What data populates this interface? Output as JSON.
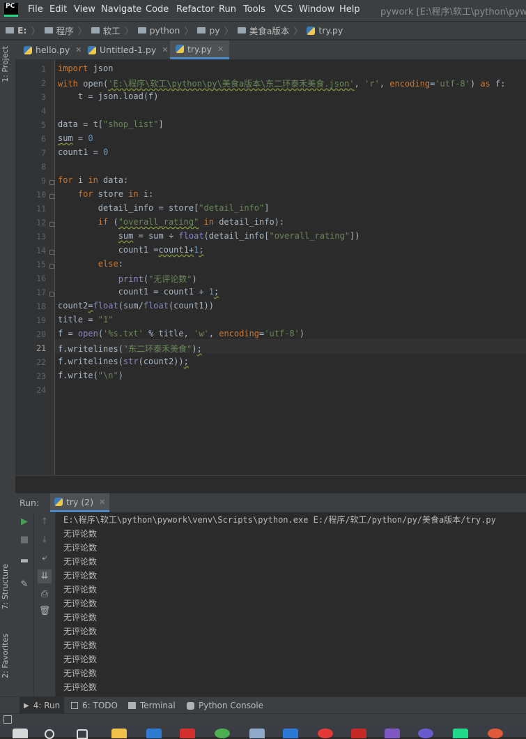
{
  "menubar": {
    "logo": "PC",
    "items": [
      "File",
      "Edit",
      "View",
      "Navigate",
      "Code",
      "Refactor",
      "Run",
      "Tools",
      "VCS",
      "Window",
      "Help"
    ],
    "window_title": "pywork [E:\\程序\\软工\\python\\pywork"
  },
  "breadcrumb": [
    "E:",
    "程序",
    "软工",
    "python",
    "py",
    "美食a版本",
    "try.py"
  ],
  "sidebar": {
    "project_tab": "1: Project",
    "structure_tab": "7: Structure",
    "favorites_tab": "2: Favorites"
  },
  "tabs": [
    {
      "label": "hello.py"
    },
    {
      "label": "Untitled-1.py"
    },
    {
      "label": "try.py"
    }
  ],
  "editor": {
    "line_numbers": [
      "1",
      "2",
      "3",
      "4",
      "5",
      "6",
      "7",
      "8",
      "9",
      "10",
      "11",
      "12",
      "13",
      "14",
      "15",
      "16",
      "17",
      "18",
      "19",
      "20",
      "21",
      "22",
      "23",
      "24"
    ],
    "current_line": "21",
    "code": {
      "l1_kw": "import",
      "l1_rest": " json",
      "l2_kw": "with",
      "l2_a": " open(",
      "l2_str": "'E:\\程序\\软工\\python\\py\\美食a版本\\东二环泰禾美食.json'",
      "l2_b": ", ",
      "l2_str2": "'r'",
      "l2_c": ", ",
      "l2_param": "encoding",
      "l2_d": "=",
      "l2_str3": "'utf-8'",
      "l2_e": ") ",
      "l2_kw2": "as",
      "l2_f": " f:",
      "l3": "    t = json.load(f)",
      "l5_a": "data = t[",
      "l5_str": "\"shop_list\"",
      "l5_b": "]",
      "l6_var": "sum",
      "l6_a": " = ",
      "l6_num": "0",
      "l7_a": "count1 = ",
      "l7_num": "0",
      "l9_kw": "for",
      "l9_a": " i ",
      "l9_kw2": "in",
      "l9_b": " data:",
      "l10_kw": "    for",
      "l10_a": " store ",
      "l10_kw2": "in",
      "l10_b": " i:",
      "l11_a": "        detail_info = store[",
      "l11_str": "\"detail_info\"",
      "l11_b": "]",
      "l12_kw": "        if",
      "l12_a": " (",
      "l12_str": "\"overall_rating\"",
      "l12_kw2": " in",
      "l12_b": " detail_info):",
      "l13_a": "            ",
      "l13_var": "sum",
      "l13_b": " = sum + ",
      "l13_bi": "float",
      "l13_c": "(detail_info[",
      "l13_str": "\"overall_rating\"",
      "l13_d": "])",
      "l14_a": "            count1 =",
      "l14_u": "count1+",
      "l14_num": "1",
      "l14_b": ";",
      "l15_kw": "        else",
      "l15_a": ":",
      "l16_a": "            ",
      "l16_bi": "print",
      "l16_b": "(",
      "l16_str": "\"无评论数\"",
      "l16_c": ")",
      "l17_a": "            count1 = count1 + ",
      "l17_num": "1",
      "l17_b": ";",
      "l18_a": "count2",
      "l18_u": "=",
      "l18_bi": "float",
      "l18_b": "(sum/",
      "l18_bi2": "float",
      "l18_c": "(count1))",
      "l19_a": "title = ",
      "l19_str": "\"1\"",
      "l20_a": "f = ",
      "l20_bi": "open",
      "l20_b": "(",
      "l20_str": "'%s.txt'",
      "l20_c": " % title, ",
      "l20_str2": "'w'",
      "l20_d": ", ",
      "l20_param": "encoding",
      "l20_e": "=",
      "l20_str3": "'utf-8'",
      "l20_f": ")",
      "l21_a": "f.writelines(",
      "l21_str": "\"东二环泰禾美食\"",
      "l21_b": ")",
      "l21_c": ";",
      "l22_a": "f.writelines(",
      "l22_bi": "str",
      "l22_b": "(count2))",
      "l22_c": ";",
      "l23_a": "f.write(",
      "l23_str": "\"\\n\"",
      "l23_b": ")"
    }
  },
  "run_panel": {
    "label": "Run:",
    "tab": "try (2)",
    "command": "E:\\程序\\软工\\python\\pywork\\venv\\Scripts\\python.exe E:/程序/软工/python/py/美食a版本/try.py",
    "output_lines": [
      "无评论数",
      "无评论数",
      "无评论数",
      "无评论数",
      "无评论数",
      "无评论数",
      "无评论数",
      "无评论数",
      "无评论数",
      "无评论数",
      "无评论数",
      "无评论数"
    ]
  },
  "bottom_tabs": [
    {
      "label": "4: Run"
    },
    {
      "label": "6: TODO"
    },
    {
      "label": "Terminal"
    },
    {
      "label": "Python Console"
    }
  ],
  "colors": {
    "keyword": "#cc7832",
    "string": "#6a8759",
    "number": "#6897bb",
    "builtin": "#8888c6",
    "accent": "#4a88c7",
    "run_green": "#499c54"
  }
}
